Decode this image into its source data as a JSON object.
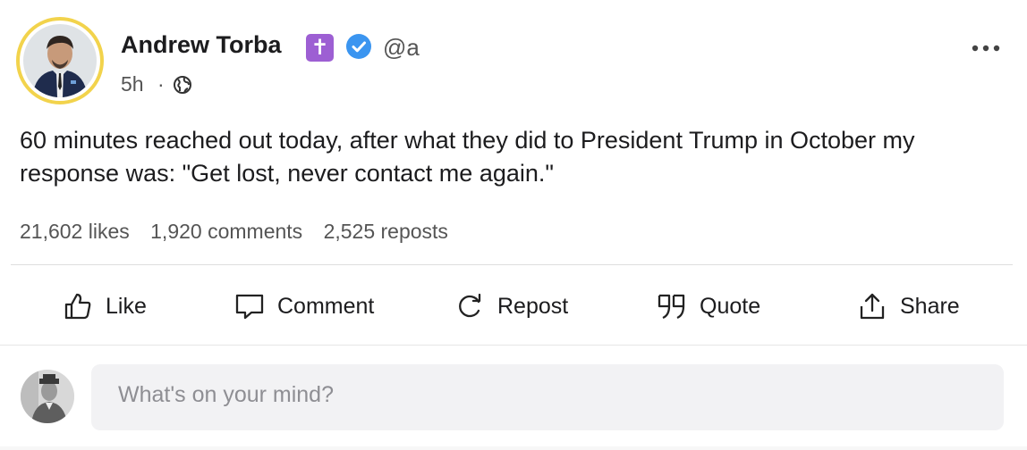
{
  "author": {
    "name": "Andrew Torba",
    "handle": "@a",
    "time": "5h",
    "separator": "·"
  },
  "post": {
    "text": "60 minutes reached out today, after what they did to President Trump in October my response was: \"Get lost, never contact me again.\""
  },
  "stats": {
    "likes": "21,602 likes",
    "comments": "1,920 comments",
    "reposts": "2,525 reposts"
  },
  "actions": {
    "like": "Like",
    "comment": "Comment",
    "repost": "Repost",
    "quote": "Quote",
    "share": "Share"
  },
  "composer": {
    "placeholder": "What's on your mind?"
  },
  "colors": {
    "avatar_ring": "#f2d34c",
    "badge_purple": "#9d5fd3",
    "verified_blue": "#3b95f0"
  },
  "icons": {
    "badge": "cross-icon",
    "verified": "verified-check-icon",
    "visibility": "globe-icon",
    "more": "ellipsis-icon"
  }
}
